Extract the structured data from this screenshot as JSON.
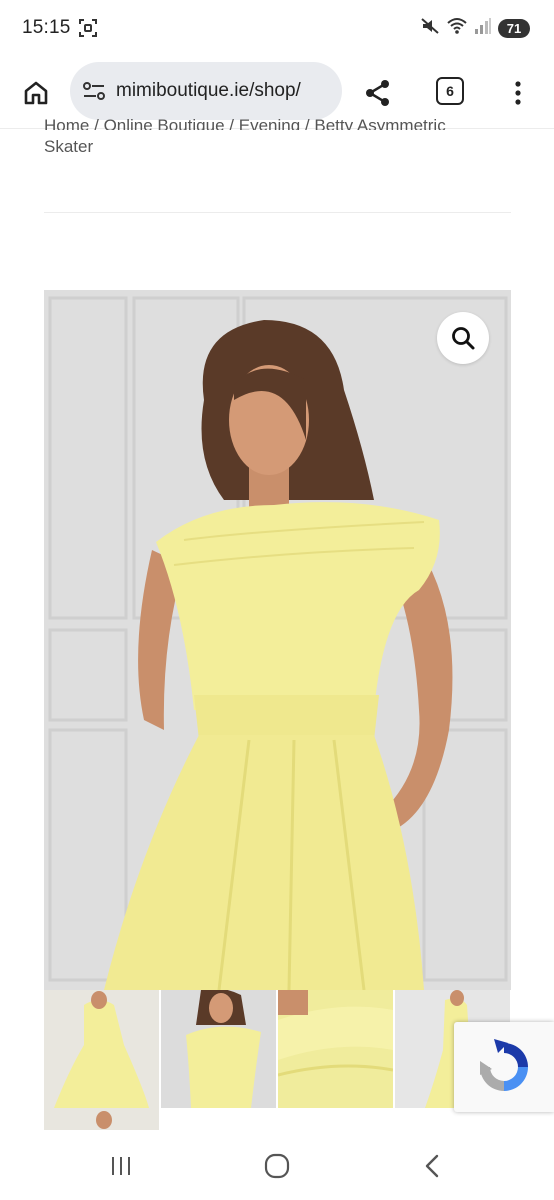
{
  "status_bar": {
    "time": "15:15",
    "battery_level": "71",
    "icons": [
      "screenshot-icon",
      "mute-icon",
      "wifi-icon",
      "signal-icon",
      "battery-icon"
    ]
  },
  "browser": {
    "url": "mimiboutique.ie/shop/",
    "tab_count": "6",
    "icons": [
      "home-icon",
      "site-settings-icon",
      "share-icon",
      "tabs-icon",
      "more-menu-icon"
    ]
  },
  "breadcrumb": {
    "items": [
      "Home",
      "Online Boutique",
      "Evening"
    ],
    "current_line1": "Betty Asymmetric",
    "current_line2": "Skater"
  },
  "product": {
    "zoom_icon": "search-icon",
    "dress_color": "#f3ee9a",
    "background_color": "#dcdcdc"
  },
  "thumbnails": {
    "count": 5
  },
  "nav": {
    "icons": [
      "recent-apps-icon",
      "home-circle-icon",
      "back-icon"
    ]
  }
}
